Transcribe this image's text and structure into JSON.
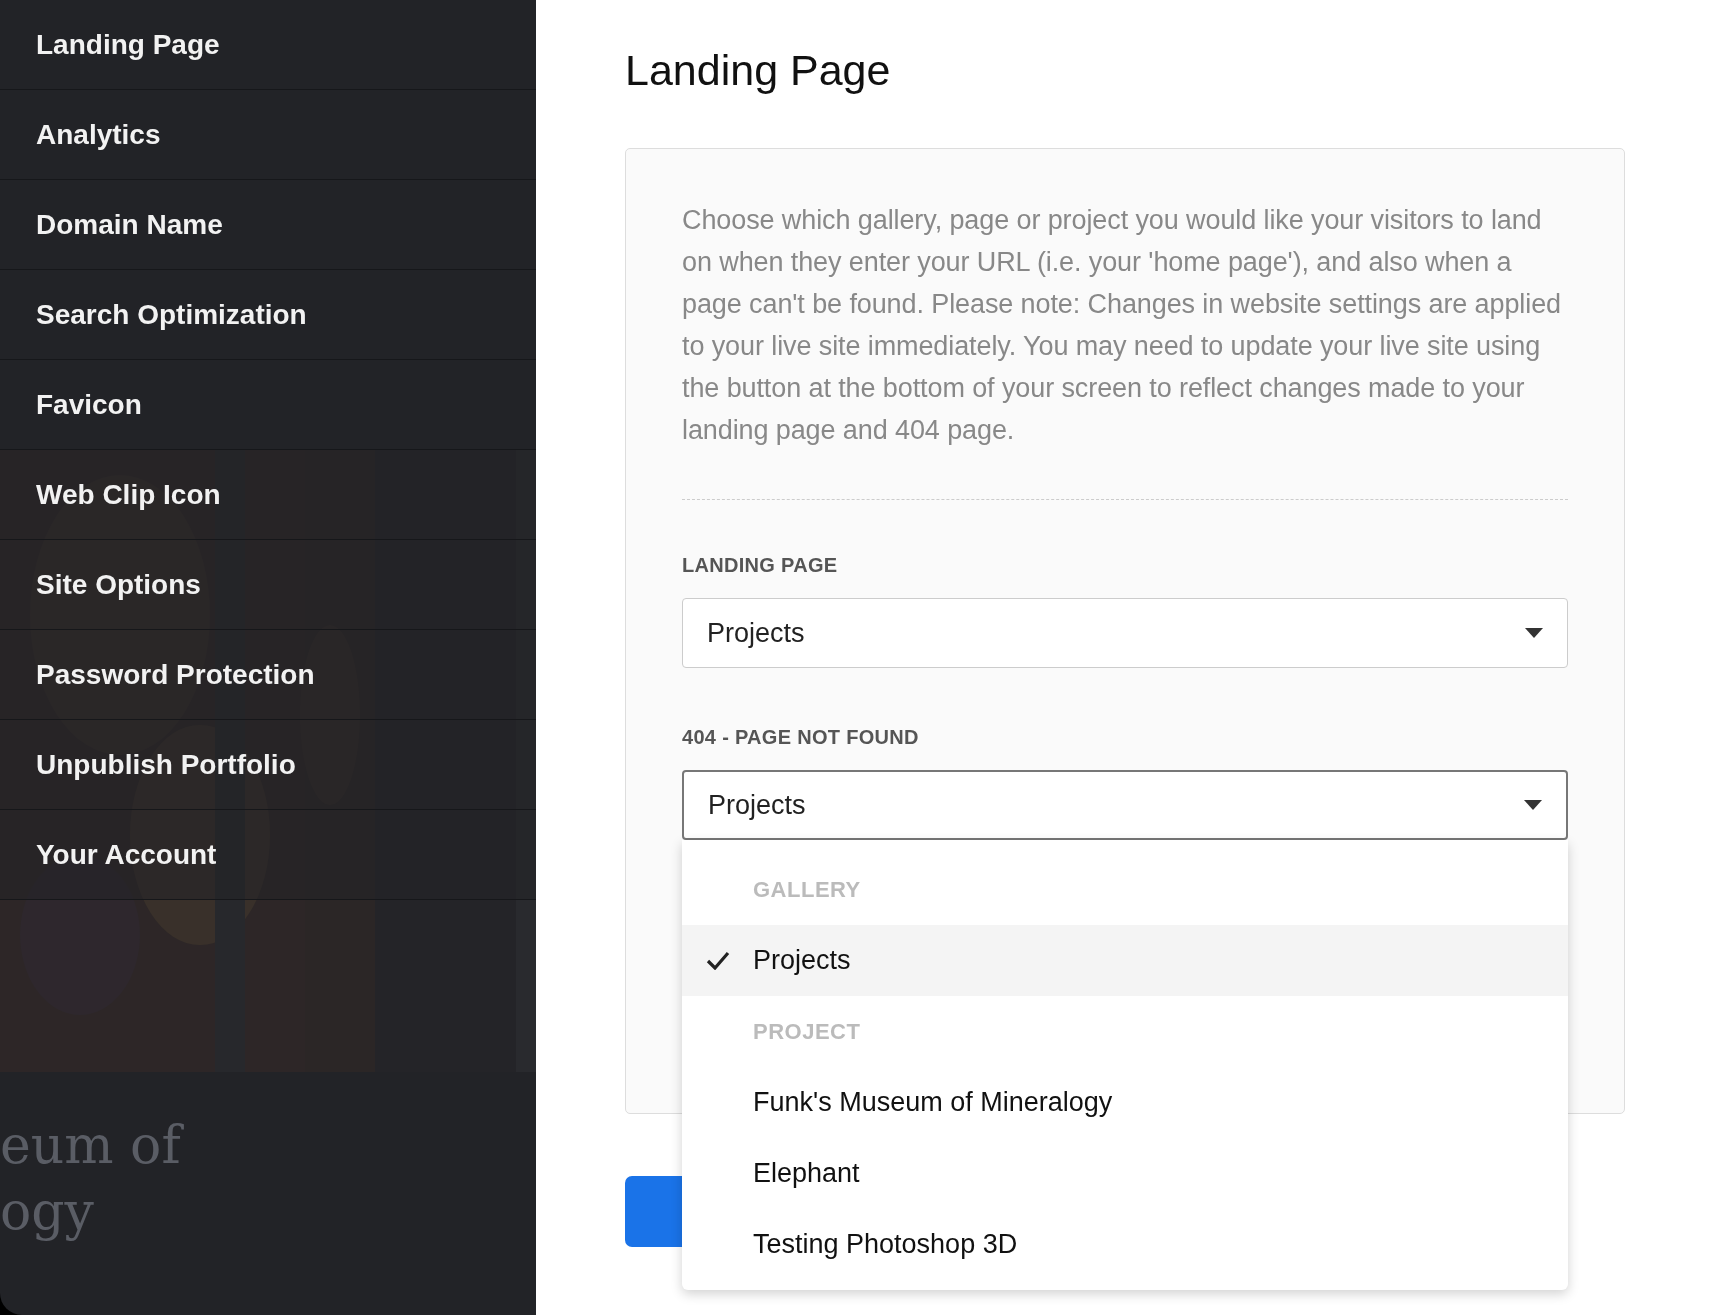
{
  "sidebar": {
    "items": [
      {
        "label": "Landing Page"
      },
      {
        "label": "Analytics"
      },
      {
        "label": "Domain Name"
      },
      {
        "label": "Search Optimization"
      },
      {
        "label": "Favicon"
      },
      {
        "label": "Web Clip Icon"
      },
      {
        "label": "Site Options"
      },
      {
        "label": "Password Protection"
      },
      {
        "label": "Unpublish Portfolio"
      },
      {
        "label": "Your Account"
      }
    ],
    "background_texts": [
      "eum of",
      "ogy"
    ]
  },
  "page": {
    "title": "Landing Page",
    "description": "Choose which gallery, page or project you would like your visitors to land on when they enter your URL (i.e. your 'home page'), and also when a page can't be found. Please note: Changes in website settings are applied to your live site immediately. You may need to update your live site using the button at the bottom of your screen to reflect changes made to your landing page and 404 page.",
    "fields": [
      {
        "label": "LANDING PAGE",
        "value": "Projects",
        "open": false
      },
      {
        "label": "404 - PAGE NOT FOUND",
        "value": "Projects",
        "open": true
      }
    ]
  },
  "dropdown": {
    "groups": [
      {
        "heading": "GALLERY",
        "options": [
          {
            "label": "Projects",
            "selected": true
          }
        ]
      },
      {
        "heading": "PROJECT",
        "options": [
          {
            "label": "Funk's Museum of Mineralogy",
            "selected": false
          },
          {
            "label": "Elephant",
            "selected": false
          },
          {
            "label": "Testing Photoshop 3D",
            "selected": false
          }
        ]
      }
    ]
  }
}
